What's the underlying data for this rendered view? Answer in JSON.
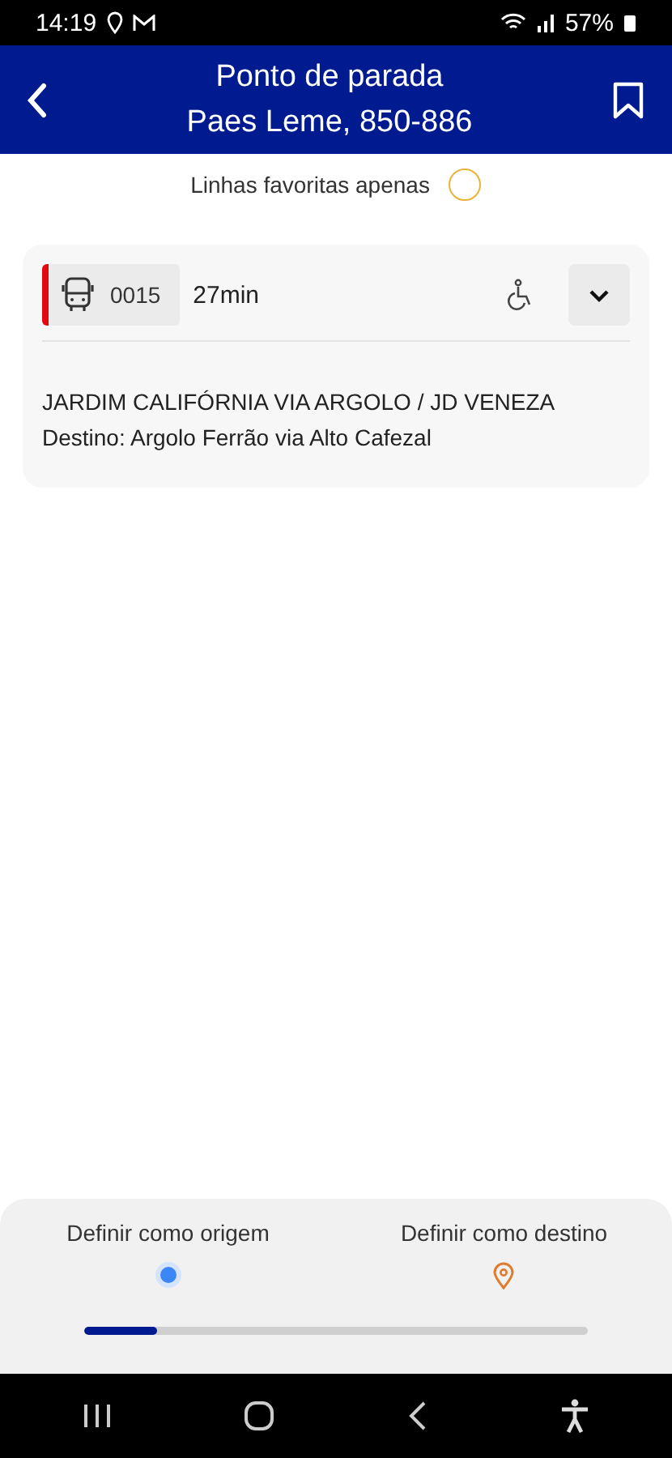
{
  "status_bar": {
    "time": "14:19",
    "battery": "57%"
  },
  "header": {
    "title": "Ponto de parada",
    "subtitle": "Paes Leme, 850-886"
  },
  "favorites_filter": {
    "label": "Linhas favoritas apenas",
    "checked": false
  },
  "routes": [
    {
      "number": "0015",
      "eta": "27min",
      "color": "#e30613",
      "accessible": true,
      "expanded": false,
      "name": "JARDIM CALIFÓRNIA VIA ARGOLO / JD VENEZA",
      "destination": "Destino: Argolo Ferrão via Alto Cafezal"
    }
  ],
  "bottom_panel": {
    "actions": [
      {
        "kind": "origin",
        "label": "Definir como origem"
      },
      {
        "kind": "destination",
        "label": "Definir como destino"
      }
    ],
    "progress": {
      "level": 0.145
    }
  }
}
